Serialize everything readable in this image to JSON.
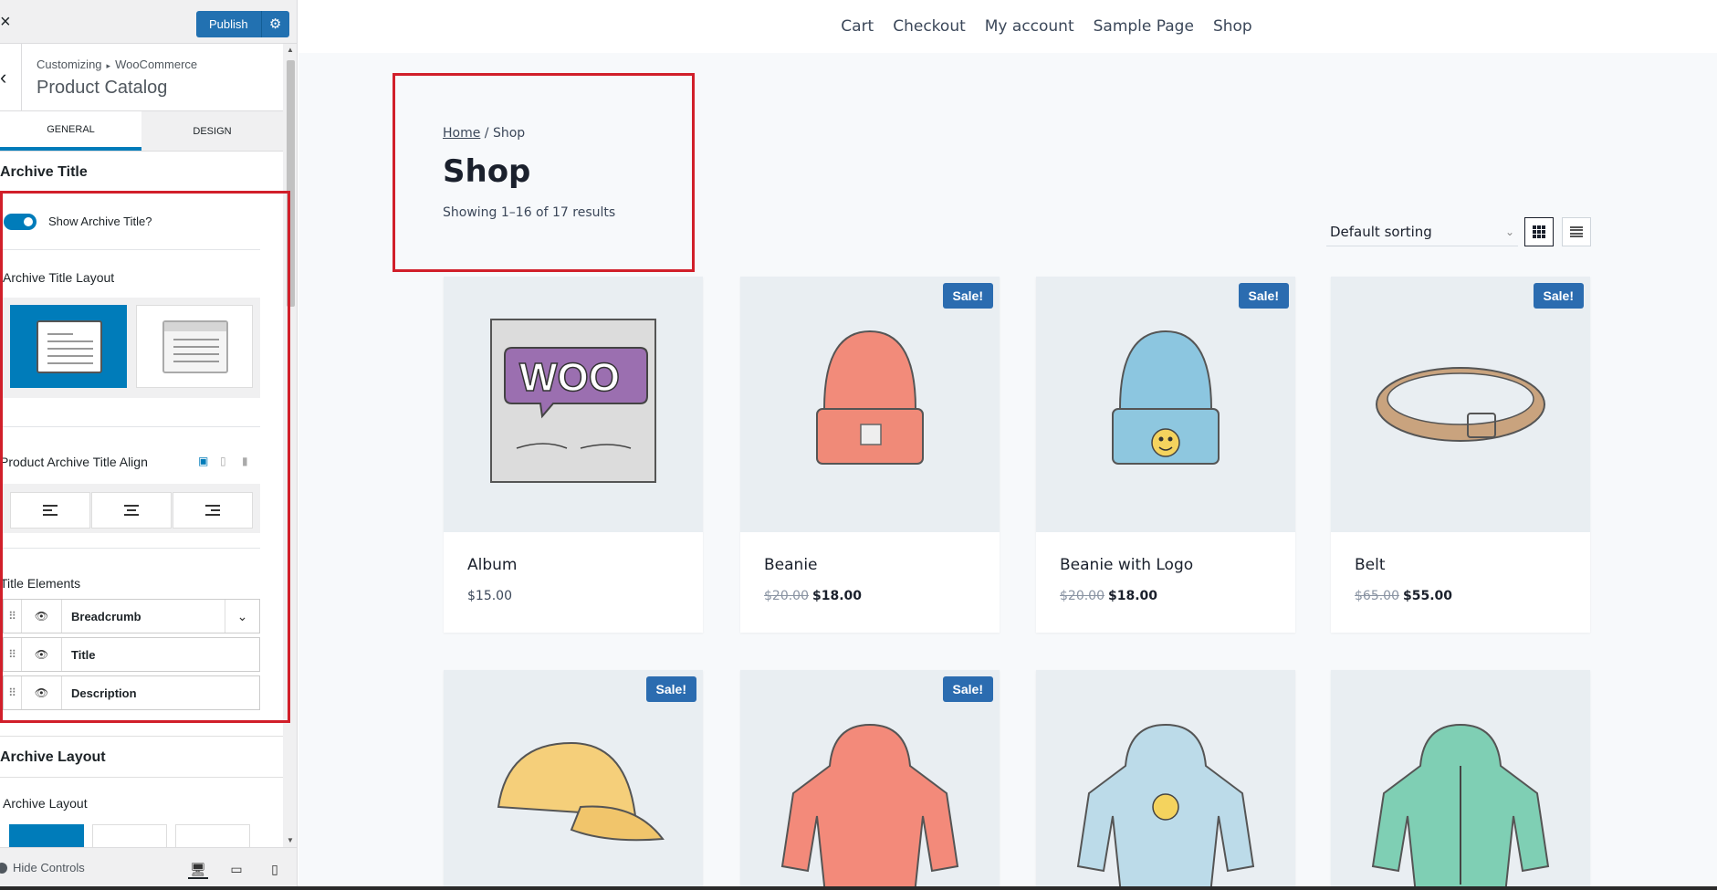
{
  "sidebar": {
    "close_icon": "×",
    "publish_label": "Publish",
    "breadcrumb": [
      "Customizing",
      "WooCommerce"
    ],
    "section_title": "Product Catalog",
    "tabs": [
      {
        "label": "General",
        "active": true
      },
      {
        "label": "Design",
        "active": false
      }
    ],
    "archive_title_heading": "Archive Title",
    "show_archive_title_label": "Show Archive Title?",
    "archive_title_layout_label": "Archive Title Layout",
    "title_align_label": "Product Archive Title Align",
    "title_elements_label": "Title Elements",
    "title_elements": [
      {
        "name": "Breadcrumb",
        "expandable": true
      },
      {
        "name": "Title",
        "expandable": false
      },
      {
        "name": "Description",
        "expandable": false
      }
    ],
    "archive_layout_heading": "Archive Layout",
    "archive_layout_label": "Archive Layout",
    "hide_controls_label": "Hide Controls",
    "accent_color": "#007cba",
    "highlight_color": "#d11f2a"
  },
  "preview": {
    "nav": [
      "Cart",
      "Checkout",
      "My account",
      "Sample Page",
      "Shop"
    ],
    "breadcrumb_home": "Home",
    "breadcrumb_sep": " / ",
    "breadcrumb_current": "Shop",
    "page_title": "Shop",
    "results": "Showing 1–16 of 17 results",
    "sort_value": "Default sorting",
    "sale_badge": "Sale!",
    "products": [
      {
        "name": "Album",
        "price": "$15.00",
        "old_price": "",
        "sale": false,
        "image": "woo-album"
      },
      {
        "name": "Beanie",
        "price": "$18.00",
        "old_price": "$20.00",
        "sale": true,
        "image": "beanie"
      },
      {
        "name": "Beanie with Logo",
        "price": "$18.00",
        "old_price": "$20.00",
        "sale": true,
        "image": "beanie-logo"
      },
      {
        "name": "Belt",
        "price": "$55.00",
        "old_price": "$65.00",
        "sale": true,
        "image": "belt"
      },
      {
        "name": "",
        "price": "",
        "old_price": "",
        "sale": true,
        "image": "cap"
      },
      {
        "name": "",
        "price": "",
        "old_price": "",
        "sale": true,
        "image": "hoodie"
      },
      {
        "name": "",
        "price": "",
        "old_price": "",
        "sale": false,
        "image": "hoodie-logo"
      },
      {
        "name": "",
        "price": "",
        "old_price": "",
        "sale": false,
        "image": "hoodie-zipper"
      }
    ]
  }
}
